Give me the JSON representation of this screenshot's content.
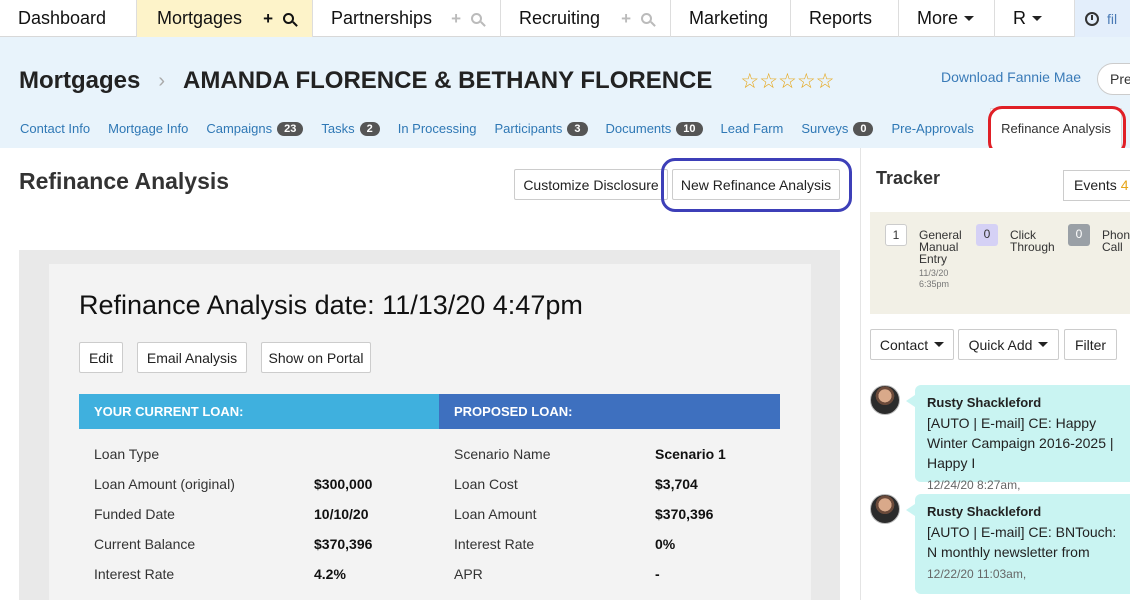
{
  "topnav": {
    "items": [
      {
        "label": "Dashboard"
      },
      {
        "label": "Mortgages"
      },
      {
        "label": "Partnerships"
      },
      {
        "label": "Recruiting"
      },
      {
        "label": "Marketing"
      },
      {
        "label": "Reports"
      },
      {
        "label": "More"
      },
      {
        "label": "R"
      }
    ],
    "clock_text": "fil"
  },
  "header": {
    "section": "Mortgages",
    "client_name": "AMANDA FLORENCE & BETHANY FLORENCE",
    "stars": "☆☆☆☆☆",
    "download_link": "Download Fannie Mae",
    "pre_button": "Pre"
  },
  "subtabs": [
    {
      "label": "Contact Info",
      "badge": ""
    },
    {
      "label": "Mortgage Info",
      "badge": ""
    },
    {
      "label": "Campaigns",
      "badge": "23"
    },
    {
      "label": "Tasks",
      "badge": "2"
    },
    {
      "label": "In Processing",
      "badge": ""
    },
    {
      "label": "Participants",
      "badge": "3"
    },
    {
      "label": "Documents",
      "badge": "10"
    },
    {
      "label": "Lead Farm",
      "badge": ""
    },
    {
      "label": "Surveys",
      "badge": "0"
    },
    {
      "label": "Pre-Approvals",
      "badge": ""
    },
    {
      "label": "Refinance Analysis",
      "badge": ""
    }
  ],
  "main": {
    "title": "Refinance Analysis",
    "customize_btn": "Customize Disclosure",
    "new_btn": "New Refinance Analysis",
    "analysis_date": "Refinance Analysis date: 11/13/20 4:47pm",
    "edit_btn": "Edit",
    "email_btn": "Email Analysis",
    "portal_btn": "Show on Portal",
    "current_header": "YOUR CURRENT LOAN:",
    "proposed_header": "PROPOSED LOAN:",
    "current_rows": [
      {
        "label": "Loan Type",
        "value": ""
      },
      {
        "label": "Loan Amount (original)",
        "value": "$300,000"
      },
      {
        "label": "Funded Date",
        "value": "10/10/20"
      },
      {
        "label": "Current Balance",
        "value": "$370,396"
      },
      {
        "label": "Interest Rate",
        "value": "4.2%"
      }
    ],
    "proposed_rows": [
      {
        "label": "Scenario Name",
        "value": "Scenario 1"
      },
      {
        "label": "Loan Cost",
        "value": "$3,704"
      },
      {
        "label": "Loan Amount",
        "value": "$370,396"
      },
      {
        "label": "Interest Rate",
        "value": "0%"
      },
      {
        "label": "APR",
        "value": "-"
      }
    ]
  },
  "tracker": {
    "title": "Tracker",
    "events_label": "Events",
    "events_count": "4",
    "cards": [
      {
        "count": "1",
        "label_lines": [
          "General",
          "Manual",
          "Entry"
        ],
        "date_lines": [
          "11/3/20",
          "6:35pm"
        ]
      },
      {
        "count": "0",
        "label_lines": [
          "Click",
          "Through"
        ]
      },
      {
        "count": "0",
        "label_lines": [
          "Phone",
          "Call"
        ]
      }
    ],
    "contact_btn": "Contact",
    "quickadd_btn": "Quick Add",
    "filter_btn": "Filter",
    "feed": [
      {
        "author": "Rusty Shackleford",
        "text": "[AUTO | E-mail] CE: Happy Winter Campaign 2016-2025 | Happy I",
        "time": "12/24/20 8:27am,"
      },
      {
        "author": "Rusty Shackleford",
        "text": "[AUTO | E-mail] CE: BNTouch: N monthly newsletter from",
        "time": "12/22/20 11:03am,"
      }
    ]
  },
  "colors": {
    "current_header": "#3fb0de",
    "proposed_header": "#3e70bf",
    "red_highlight": "#e01f26",
    "blue_highlight": "#3d3fb8"
  }
}
